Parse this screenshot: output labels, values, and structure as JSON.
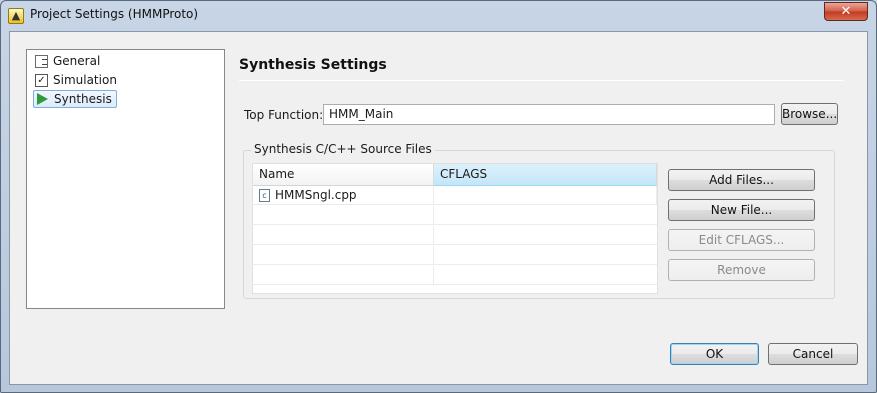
{
  "window": {
    "title": "Project Settings (HMMProto)",
    "close_glyph": "✕"
  },
  "nav": {
    "items": [
      {
        "label": "General",
        "icon": "general-settings-icon"
      },
      {
        "label": "Simulation",
        "icon": "checkbox-icon",
        "checked": true
      },
      {
        "label": "Synthesis",
        "icon": "play-icon",
        "selected": true
      }
    ],
    "check_glyph": "✓"
  },
  "synthesis": {
    "heading": "Synthesis Settings",
    "top_function_label": "Top Function:",
    "top_function_value": "HMM_Main",
    "browse_label": "Browse...",
    "group_title": "Synthesis C/C++ Source Files",
    "columns": [
      "Name",
      "CFLAGS"
    ],
    "files": [
      {
        "name": "HMMSngl.cpp",
        "cflags": "",
        "icon": "c-source-file-icon",
        "icon_glyph": "c"
      }
    ],
    "buttons": {
      "add_files": "Add Files...",
      "new_file": "New File...",
      "edit_cflags": "Edit CFLAGS...",
      "remove": "Remove"
    }
  },
  "footer": {
    "ok": "OK",
    "cancel": "Cancel"
  },
  "colors": {
    "selection": "#dcebfc",
    "sorted_header": "#c4e6f8",
    "close_button": "#c0391f"
  }
}
